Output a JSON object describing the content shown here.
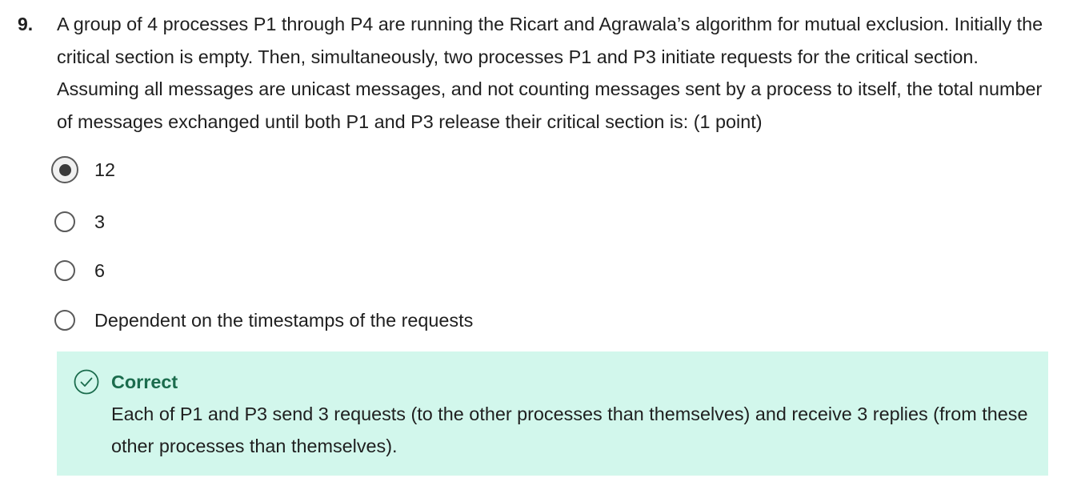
{
  "question": {
    "number": "9.",
    "text": "A group of 4 processes P1 through P4 are running the Ricart and Agrawala’s algorithm for mutual exclusion. Initially the critical section is empty. Then, simultaneously, two processes P1 and P3 initiate requests for the critical section. Assuming all messages are unicast messages, and not counting messages sent by a process to itself, the total number of messages exchanged until both P1 and P3 release their critical section is: (1 point)"
  },
  "options": [
    {
      "label": "12",
      "selected": true
    },
    {
      "label": "3",
      "selected": false
    },
    {
      "label": "6",
      "selected": false
    },
    {
      "label": "Dependent on the timestamps of the requests",
      "selected": false
    }
  ],
  "feedback": {
    "status": "Correct",
    "icon": "check-circle-icon",
    "explanation": "Each of P1 and P3 send 3 requests (to the other processes than themselves) and receive 3 replies (from these other processes than themselves).",
    "status_color": "#1b6c4d",
    "background_color": "#d2f7ec"
  }
}
